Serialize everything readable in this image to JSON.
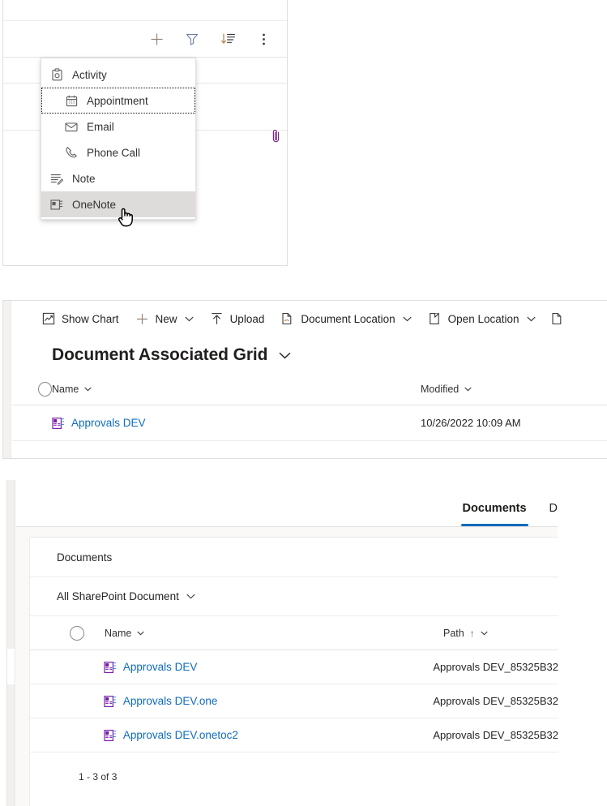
{
  "panel_one": {
    "toolbar_icons": [
      {
        "name": "add-icon",
        "label": "New"
      },
      {
        "name": "filter-icon",
        "label": "Filter"
      },
      {
        "name": "sort-icon",
        "label": "Sort"
      },
      {
        "name": "more-vertical-icon",
        "label": "More commands"
      }
    ],
    "attachment_icon": "paperclip-icon",
    "menu": {
      "items": [
        {
          "label": "Activity",
          "icon": "activity-icon",
          "indent": false,
          "state": "normal"
        },
        {
          "label": "Appointment",
          "icon": "calendar-icon",
          "indent": true,
          "state": "focused"
        },
        {
          "label": "Email",
          "icon": "mail-icon",
          "indent": true,
          "state": "normal"
        },
        {
          "label": "Phone Call",
          "icon": "phone-icon",
          "indent": true,
          "state": "normal"
        },
        {
          "label": "Note",
          "icon": "note-icon",
          "indent": false,
          "state": "normal"
        },
        {
          "label": "OneNote",
          "icon": "onenote-icon",
          "indent": false,
          "state": "selected"
        }
      ],
      "selected_highlight": "#dedcdb"
    },
    "cursor": "hand-pointer-cursor"
  },
  "panel_two": {
    "commands": [
      {
        "label": "Show Chart",
        "icon": "show-chart-icon",
        "chevron": false
      },
      {
        "label": "New",
        "icon": "add-icon",
        "chevron": true
      },
      {
        "label": "Upload",
        "icon": "upload-icon",
        "chevron": false
      },
      {
        "label": "Document Location",
        "icon": "document-location-icon",
        "chevron": true
      },
      {
        "label": "Open Location",
        "icon": "open-location-icon",
        "chevron": true
      }
    ],
    "overflow_icon": "document-icon",
    "view_name": "Document Associated Grid",
    "columns": [
      {
        "label": "Name",
        "sort": "none"
      },
      {
        "label": "Modified",
        "sort": "none"
      }
    ],
    "rows": [
      {
        "name": "Approvals DEV",
        "icon": "onenote-file-icon",
        "modified": "10/26/2022 10:09 AM"
      }
    ]
  },
  "panel_three": {
    "tabs": [
      {
        "label": "Documents",
        "active": true,
        "clipped": false
      },
      {
        "label": "D",
        "active": false,
        "clipped": true
      }
    ],
    "card_title": "Documents",
    "view_selector": "All SharePoint Document",
    "columns": [
      {
        "label": "Name",
        "sort": "none"
      },
      {
        "label": "Path",
        "sort": "asc",
        "sort_glyph": "↑"
      }
    ],
    "rows": [
      {
        "name": "Approvals DEV",
        "icon": "onenote-file-icon",
        "path": "Approvals DEV_85325B32"
      },
      {
        "name": "Approvals DEV.one",
        "icon": "onenote-file-icon",
        "path": "Approvals DEV_85325B32"
      },
      {
        "name": "Approvals DEV.onetoc2",
        "icon": "onenote-file-icon",
        "path": "Approvals DEV_85325B32"
      }
    ],
    "pagination": "1 - 3 of 3",
    "accent_color": "#0f6cbd",
    "link_color": "#0f6cbd"
  }
}
